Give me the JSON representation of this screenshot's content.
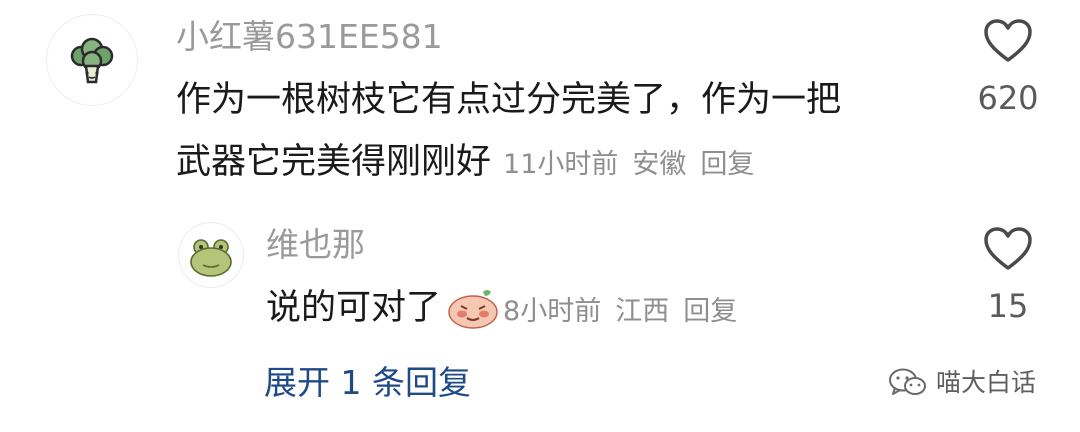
{
  "comments": [
    {
      "username": "小红薯631EE581",
      "text_line1": "作为一根树枝它有点过分完美了，作为一把",
      "text_line2": "武器它完美得刚刚好",
      "time": "11小时前",
      "location": "安徽",
      "reply_label": "回复",
      "like_count": "620",
      "avatar_icon": "broccoli-icon"
    },
    {
      "username": "维也那",
      "text": "说的可对了",
      "emoji_icon": "blushing-face-emoji-icon",
      "time": "8小时前",
      "location": "江西",
      "reply_label": "回复",
      "like_count": "15",
      "avatar_icon": "frog-icon"
    }
  ],
  "expand_replies": "展开 1 条回复",
  "watermark": {
    "icon": "wechat-icon",
    "text": "喵大白话"
  },
  "colors": {
    "text": "#1a1a1a",
    "meta": "#8f8f8f",
    "link": "#1f4a87"
  }
}
